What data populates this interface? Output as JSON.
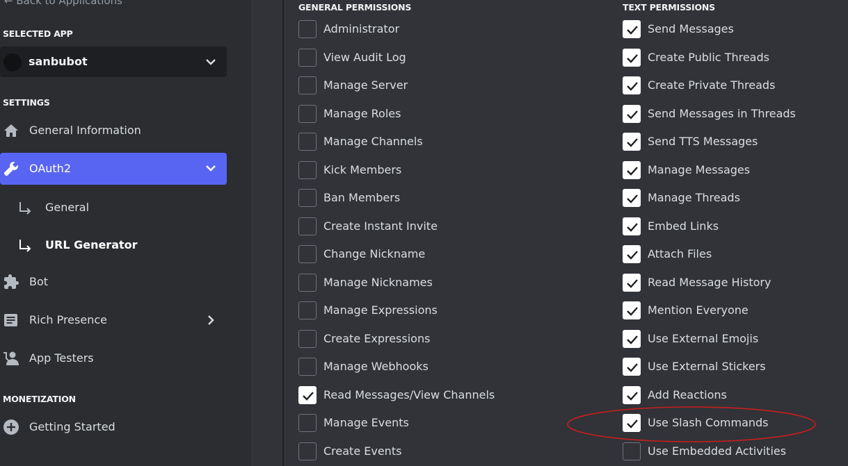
{
  "sidebar": {
    "back_label": "← Back to Applications",
    "selected_app_label": "SELECTED APP",
    "app_name": "sanbubot",
    "settings_label": "SETTINGS",
    "items": [
      {
        "label": "General Information",
        "icon": "home-icon"
      },
      {
        "label": "OAuth2",
        "icon": "wrench-icon",
        "active": true
      },
      {
        "label": "General",
        "icon": "subitem-arrow-icon"
      },
      {
        "label": "URL Generator",
        "icon": "subitem-arrow-icon"
      },
      {
        "label": "Bot",
        "icon": "puzzle-icon"
      },
      {
        "label": "Rich Presence",
        "icon": "document-icon"
      },
      {
        "label": "App Testers",
        "icon": "user-icon"
      }
    ],
    "monetization_label": "MONETIZATION",
    "getting_started_label": "Getting Started"
  },
  "permissions": {
    "general_header": "GENERAL PERMISSIONS",
    "text_header": "TEXT PERMISSIONS",
    "general": [
      {
        "label": "Administrator",
        "checked": false
      },
      {
        "label": "View Audit Log",
        "checked": false
      },
      {
        "label": "Manage Server",
        "checked": false
      },
      {
        "label": "Manage Roles",
        "checked": false
      },
      {
        "label": "Manage Channels",
        "checked": false
      },
      {
        "label": "Kick Members",
        "checked": false
      },
      {
        "label": "Ban Members",
        "checked": false
      },
      {
        "label": "Create Instant Invite",
        "checked": false
      },
      {
        "label": "Change Nickname",
        "checked": false
      },
      {
        "label": "Manage Nicknames",
        "checked": false
      },
      {
        "label": "Manage Expressions",
        "checked": false
      },
      {
        "label": "Create Expressions",
        "checked": false
      },
      {
        "label": "Manage Webhooks",
        "checked": false
      },
      {
        "label": "Read Messages/View Channels",
        "checked": true
      },
      {
        "label": "Manage Events",
        "checked": false
      },
      {
        "label": "Create Events",
        "checked": false
      }
    ],
    "text": [
      {
        "label": "Send Messages",
        "checked": true
      },
      {
        "label": "Create Public Threads",
        "checked": true
      },
      {
        "label": "Create Private Threads",
        "checked": true
      },
      {
        "label": "Send Messages in Threads",
        "checked": true
      },
      {
        "label": "Send TTS Messages",
        "checked": true
      },
      {
        "label": "Manage Messages",
        "checked": true
      },
      {
        "label": "Manage Threads",
        "checked": true
      },
      {
        "label": "Embed Links",
        "checked": true
      },
      {
        "label": "Attach Files",
        "checked": true
      },
      {
        "label": "Read Message History",
        "checked": true
      },
      {
        "label": "Mention Everyone",
        "checked": true
      },
      {
        "label": "Use External Emojis",
        "checked": true
      },
      {
        "label": "Use External Stickers",
        "checked": true
      },
      {
        "label": "Add Reactions",
        "checked": true
      },
      {
        "label": "Use Slash Commands",
        "checked": true
      },
      {
        "label": "Use Embedded Activities",
        "checked": false
      }
    ]
  },
  "colors": {
    "accent": "#5865f2",
    "annotation": "#c81e1e"
  }
}
